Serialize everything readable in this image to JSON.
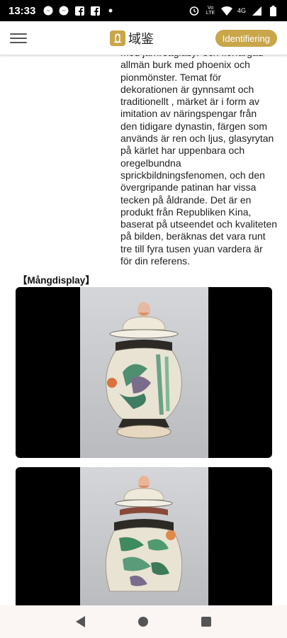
{
  "status_bar": {
    "time": "13:33",
    "notifications": [
      "messenger-icon",
      "messenger-icon",
      "facebook-icon",
      "facebook-icon",
      "dot-icon"
    ],
    "system": [
      "alarm-icon",
      "volte-icon",
      "wifi-icon",
      "4g-icon",
      "signal-icon",
      "battery-icon"
    ],
    "volte_label": "Vo LTE",
    "network_label": "4G"
  },
  "header": {
    "logo_text": "域鉴",
    "identify_button": "Identifiering"
  },
  "article": {
    "paragraph_lines": [
      "med järnröttglasyr och flerfärgad",
      "allmän burk med phoenix och",
      "pionmönster. Temat för",
      "dekorationen är gynnsamt och",
      "traditionellt , märket är i form av",
      "imitation av näringspengar från",
      "den tidigare dynastin, färgen som",
      "används är ren och ljus, glasyrytan",
      "på kärlet har uppenbara och",
      "oregelbundna",
      "sprickbildningsfenomen, och den",
      "övergripande patinan har vissa",
      "tecken på åldrande. Det är en",
      "produkt från Republiken Kina,",
      "baserat på utseendet och kvaliteten",
      "på bilden, beräknas det vara runt",
      "tre till fyra tusen yuan vardera är",
      "för din referens."
    ],
    "section_title": "【Mångdisplay】",
    "photos": [
      "vase-photo",
      "vase-photo"
    ]
  },
  "colors": {
    "accent": "#c9a64a",
    "text": "#222222"
  },
  "nav": [
    "back-icon",
    "home-icon",
    "recents-icon"
  ]
}
